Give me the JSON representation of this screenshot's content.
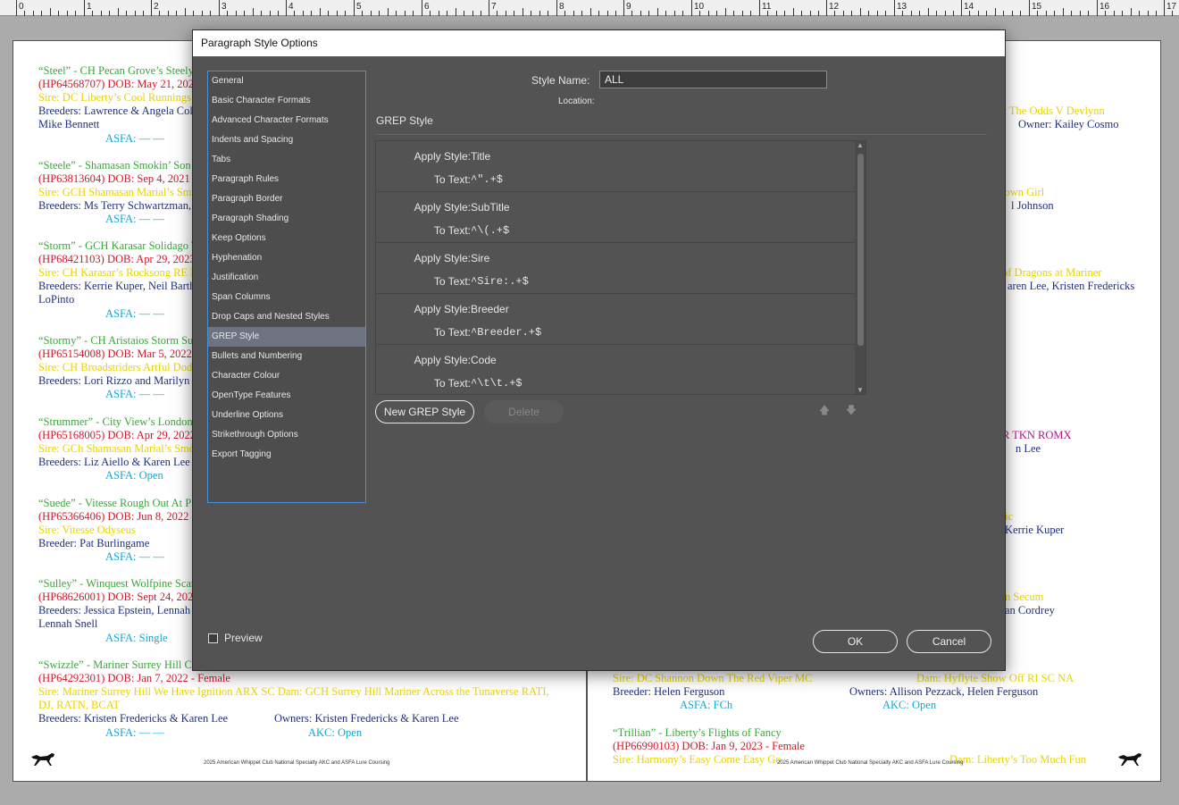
{
  "ruler": {
    "numbers": [
      "0",
      "1",
      "2",
      "3",
      "4",
      "5",
      "6",
      "7",
      "8",
      "9",
      "10",
      "11",
      "12",
      "13",
      "14",
      "15",
      "16",
      "17"
    ]
  },
  "left_page": {
    "lines": [
      {
        "text": "“Steel” - CH Pecan Grove’s Steely-D",
        "color": "title"
      },
      {
        "text": "(HP64568707) DOB: May 21, 2022 -",
        "color": "red"
      },
      {
        "text": "Sire: DC Liberty’s Cool Runnings",
        "color": "yellow"
      },
      {
        "text": "Breeders: Lawrence & Angela Coll",
        "color": "blue"
      },
      {
        "text": "Mike Bennett",
        "color": "blue"
      },
      {
        "text": "ASFA: — —",
        "color": "cyan"
      },
      {
        "text": "“Steele” - Shamasan Smokin’ Son o",
        "color": "title"
      },
      {
        "text": "(HP63813604) DOB: Sep 4, 2021 -",
        "color": "red"
      },
      {
        "text": "Sire: GCH Shamasan Marial’s Smo",
        "color": "yellow"
      },
      {
        "text": "Breeders: Ms Terry Schwartzman,",
        "color": "blue"
      },
      {
        "text": "ASFA: — —",
        "color": "cyan"
      },
      {
        "text": "“Storm” - GCH Karasar Solidago T",
        "color": "title"
      },
      {
        "text": "(HP68421103) DOB: Apr 29, 2023",
        "color": "red"
      },
      {
        "text": "Sire: CH Karasar’s Rocksong RE D",
        "color": "yellow"
      },
      {
        "text": "Breeders: Kerrie Kuper, Neil Barth",
        "color": "blue"
      },
      {
        "text": "LoPinto",
        "color": "blue"
      },
      {
        "text": "ASFA: — —",
        "color": "cyan"
      },
      {
        "text": "“Stormy” - CH Aristaios Storm Su",
        "color": "title"
      },
      {
        "text": "(HP65154008) DOB: Mar 5, 2022 -",
        "color": "red"
      },
      {
        "text": "Sire: CH Broadstriders Artful Dod",
        "color": "yellow"
      },
      {
        "text": "Breeders: Lori Rizzo and Marilyn A",
        "color": "blue"
      },
      {
        "text": "ASFA: — —",
        "color": "cyan"
      },
      {
        "text": "“Strummer” - City View’s London",
        "color": "title"
      },
      {
        "text": "(HP65168005) DOB: Apr 29, 2022",
        "color": "red"
      },
      {
        "text": "Sire: GCh Shamasan Marial’s Smo",
        "color": "yellow"
      },
      {
        "text": "Breeders: Liz Aiello & Karen Lee",
        "color": "blue"
      },
      {
        "text": "ASFA: Open",
        "color": "cyan"
      },
      {
        "text": "“Suede” - Vitesse Rough Out At PS",
        "color": "title"
      },
      {
        "text": "(HP65366406) DOB: Jun 8, 2022 -",
        "color": "red"
      },
      {
        "text": "Sire: Vitesse Odyseus",
        "color": "yellow"
      },
      {
        "text": "Breeder: Pat Burlingame",
        "color": "blue"
      },
      {
        "text": "ASFA: — —",
        "color": "cyan"
      },
      {
        "text": "“Sulley” - Winquest Wolfpine Scar",
        "color": "title"
      },
      {
        "text": "(HP68626001) DOB: Sept 24, 2023",
        "color": "red"
      },
      {
        "text": "Breeders: Jessica Epstein, Lennah S",
        "color": "blue"
      },
      {
        "text": "Lennah Snell",
        "color": "blue"
      },
      {
        "text": "ASFA: Single",
        "color": "cyan"
      },
      {
        "text": "“Swizzle” - Mariner Surrey Hill Co",
        "color": "title"
      },
      {
        "text": "(HP64292301) DOB: Jan 7, 2022 - Female",
        "color": "red"
      },
      {
        "text": "Sire: Mariner Surrey Hill We Have Ignition ARX SC  Dam: GCH Surrey Hill Mariner Across the Tunaverse RATI,",
        "color": "yellow"
      },
      {
        "text": "DJ, RATN, BCAT",
        "color": "yellow"
      },
      {
        "text": "Breeders: Kristen Fredericks & Karen Lee",
        "color": "blue"
      },
      {
        "text": "Owners: Kristen Fredericks & Karen Lee",
        "color": "blue"
      },
      {
        "text": "ASFA: — —",
        "color": "cyan"
      },
      {
        "text": "AKC: Open",
        "color": "cyan"
      }
    ],
    "footer": "2025 American Whippet Club National Specialty AKC and ASFA Lure Coursing"
  },
  "right_page": {
    "lines": [
      {
        "text": "at The Odds V Devlynn",
        "color": "yellow"
      },
      {
        "text": "Owner: Kailey Cosmo",
        "color": "blue"
      },
      {
        "text": "town Girl",
        "color": "yellow"
      },
      {
        "text": "l Johnson",
        "color": "blue"
      },
      {
        "text": "of Dragons at Mariner",
        "color": "yellow"
      },
      {
        "text": "aren Lee, Kristen Fredericks",
        "color": "blue"
      },
      {
        "text": "R TKN ROMX",
        "color": "magenta"
      },
      {
        "text": "n Lee",
        "color": "blue"
      },
      {
        "text": "ic",
        "color": "yellow"
      },
      {
        "text": "Kerrie Kuper",
        "color": "blue"
      },
      {
        "text": "n Secum",
        "color": "yellow"
      },
      {
        "text": "an Cordrey",
        "color": "blue"
      },
      {
        "text": "Sire: DC Shannon Down The Red Viper MC",
        "color": "yellow"
      },
      {
        "text": "Dam: Hyflyte Show Off RI SC NA",
        "color": "yellow"
      },
      {
        "text": "Breeder: Helen Ferguson",
        "color": "blue"
      },
      {
        "text": "Owners: Allison Pezzack, Helen Ferguson",
        "color": "blue"
      },
      {
        "text": "ASFA: FCh",
        "color": "cyan"
      },
      {
        "text": "AKC: Open",
        "color": "cyan"
      },
      {
        "text": "“Trillian” - Liberty’s Flights of Fancy",
        "color": "title"
      },
      {
        "text": "(HP66990103) DOB: Jan 9, 2023 - Female",
        "color": "red"
      },
      {
        "text": "Sire: Harmony’s Easy Come Easy Go",
        "color": "yellow"
      },
      {
        "text": "Dam: Liberty’s Too Much Fun",
        "color": "yellow"
      }
    ],
    "footer": "2025 American Whippet Club National Specialty AKC and ASFA Lure Coursing"
  },
  "dialog": {
    "title": "Paragraph Style Options",
    "nav": [
      "General",
      "Basic Character Formats",
      "Advanced Character Formats",
      "Indents and Spacing",
      "Tabs",
      "Paragraph Rules",
      "Paragraph Border",
      "Paragraph Shading",
      "Keep Options",
      "Hyphenation",
      "Justification",
      "Span Columns",
      "Drop Caps and Nested Styles",
      "GREP Style",
      "Bullets and Numbering",
      "Character Colour",
      "OpenType Features",
      "Underline Options",
      "Strikethrough Options",
      "Export Tagging"
    ],
    "active_nav": "GREP Style",
    "style_name_label": "Style Name:",
    "style_name_value": "ALL",
    "location_label": "Location:",
    "section_title": "GREP Style",
    "apply_label": "Apply Style:",
    "to_text_label": "To Text:",
    "grep_rules": [
      {
        "style": "Title",
        "expr": "^\".+$"
      },
      {
        "style": "SubTitle",
        "expr": "^\\(.+$"
      },
      {
        "style": "Sire",
        "expr": "^Sire:.+$"
      },
      {
        "style": "Breeder",
        "expr": "^Breeder.+$"
      },
      {
        "style": "Code",
        "expr": "^\\t\\t.+$"
      }
    ],
    "new_grep_label": "New GREP Style",
    "delete_label": "Delete",
    "preview_label": "Preview",
    "preview_checked": false,
    "ok_label": "OK",
    "cancel_label": "Cancel"
  }
}
